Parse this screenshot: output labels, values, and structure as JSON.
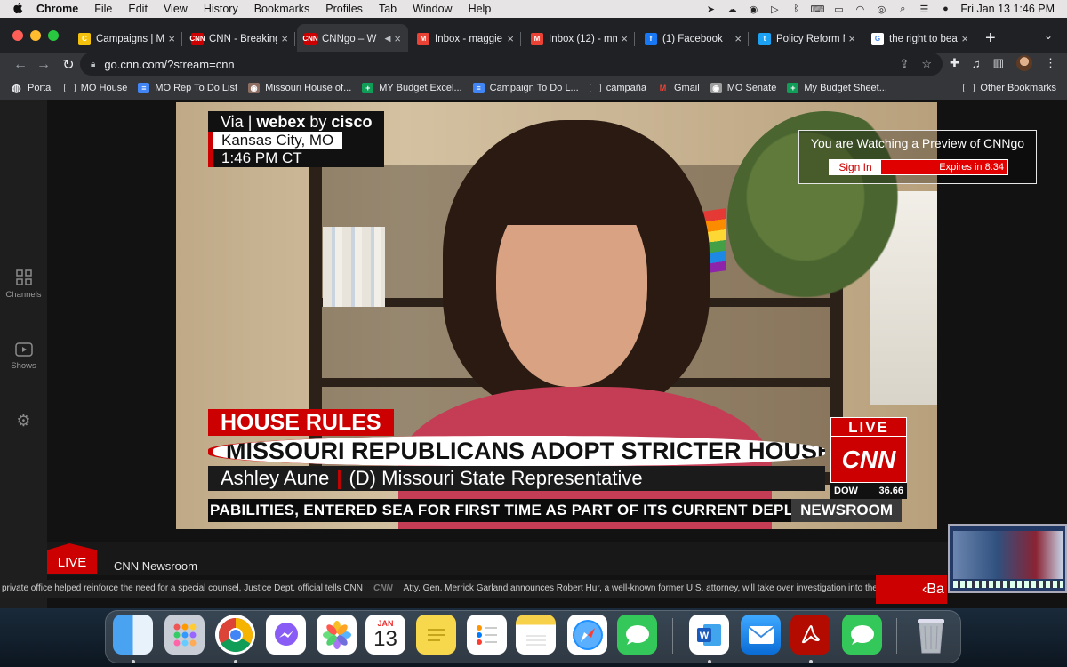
{
  "menubar": {
    "apple": "",
    "app": "Chrome",
    "items": [
      "File",
      "Edit",
      "View",
      "History",
      "Bookmarks",
      "Profiles",
      "Tab",
      "Window",
      "Help"
    ],
    "clock": "Fri Jan 13  1:46 PM"
  },
  "tabs": [
    {
      "title": "Campaigns | Ma",
      "fav": "C",
      "color": "#f4c20d"
    },
    {
      "title": "CNN - Breaking",
      "fav": "CNN",
      "color": "#cc0000"
    },
    {
      "title": "CNNgo – W",
      "fav": "CNN",
      "color": "#cc0000",
      "active": true
    },
    {
      "title": "Inbox - maggie",
      "fav": "M",
      "color": "#ea4335"
    },
    {
      "title": "Inbox (12) - mm",
      "fav": "M",
      "color": "#ea4335"
    },
    {
      "title": "(1) Facebook",
      "fav": "f",
      "color": "#1877f2"
    },
    {
      "title": "Policy Reform N",
      "fav": "t",
      "color": "#1da1f2"
    },
    {
      "title": "the right to bea",
      "fav": "G",
      "color": "#ffffff"
    }
  ],
  "address": {
    "url": "go.cnn.com/?stream=cnn"
  },
  "bookmarks": [
    {
      "label": "Portal",
      "type": "globe"
    },
    {
      "label": "MO House",
      "type": "folder"
    },
    {
      "label": "MO Rep To Do List",
      "type": "doc",
      "color": "#4285f4"
    },
    {
      "label": "Missouri House of...",
      "type": "seal",
      "color": "#8d6e63"
    },
    {
      "label": "MY Budget Excel...",
      "type": "sheet",
      "color": "#0f9d58"
    },
    {
      "label": "Campaign To Do L...",
      "type": "doc",
      "color": "#4285f4"
    },
    {
      "label": "campaña",
      "type": "folder"
    },
    {
      "label": "Gmail",
      "type": "gmail",
      "color": "#ea4335"
    },
    {
      "label": "MO Senate",
      "type": "seal",
      "color": "#9e9e9e"
    },
    {
      "label": "My Budget Sheet...",
      "type": "sheet",
      "color": "#0f9d58"
    }
  ],
  "other_bookmarks": "Other Bookmarks",
  "sidebar": {
    "channels": "Channels",
    "shows": "Shows"
  },
  "broadcast": {
    "bug_via": "Via | ",
    "bug_brand": "webex",
    "bug_by": " by ",
    "bug_cisco": "cisco",
    "bug_location": "Kansas City, MO",
    "bug_time": "1:46 PM CT",
    "tag": "HOUSE RULES",
    "headline": "MISSOURI REPUBLICANS ADOPT STRICTER HOUSE DRESS CODE FOR WOMEN",
    "name": "Ashley Aune",
    "role": "(D) Missouri State Representative",
    "live": "LIVE",
    "network": "CNN",
    "dow_label": "DOW",
    "dow_value": "36.66",
    "ticker": "PABILITIES, ENTERED SEA FOR FIRST TIME AS PART OF ITS CURRENT DEPLOY",
    "program": "NEWSROOM"
  },
  "preview": {
    "message": "You are Watching a Preview of CNNgo",
    "signin": "Sign In",
    "expires": "Expires in 8:34"
  },
  "nowplaying": {
    "live": "LIVE",
    "title": "CNN Newsroom"
  },
  "crawl": {
    "left": "private office helped reinforce the need for a special counsel, Justice Dept. official tells CNN",
    "logo": "CNN",
    "right": "Atty. Gen. Merrick Garland announces Robert Hur, a well-known former U.S. attorney, will take over investigation into the"
  },
  "back": "Ba",
  "dock": {
    "calendar_month": "JAN",
    "calendar_day": "13"
  }
}
